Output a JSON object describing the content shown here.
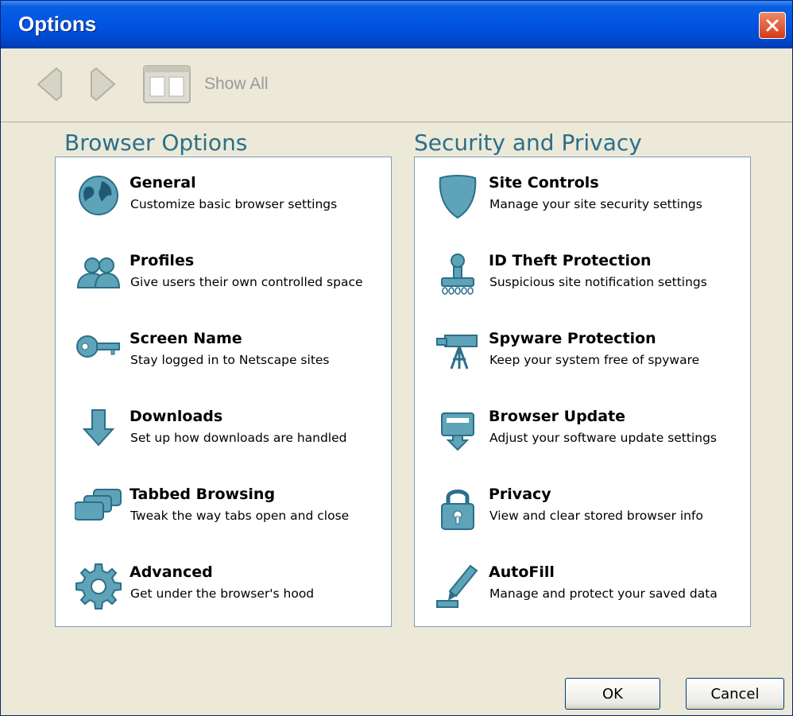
{
  "window": {
    "title": "Options"
  },
  "toolbar": {
    "show_all_label": "Show All"
  },
  "browser_options": {
    "title": "Browser Options",
    "items": [
      {
        "name": "General",
        "desc": "Customize basic browser settings",
        "icon": "globe-icon"
      },
      {
        "name": "Profiles",
        "desc": "Give users their own controlled space",
        "icon": "users-icon"
      },
      {
        "name": "Screen Name",
        "desc": "Stay logged in to Netscape sites",
        "icon": "key-icon"
      },
      {
        "name": "Downloads",
        "desc": "Set up how downloads are handled",
        "icon": "download-arrow-icon"
      },
      {
        "name": "Tabbed Browsing",
        "desc": "Tweak the way tabs open and close",
        "icon": "tabs-icon"
      },
      {
        "name": "Advanced",
        "desc": "Get under the browser's hood",
        "icon": "gear-icon"
      }
    ]
  },
  "security_privacy": {
    "title": "Security and Privacy",
    "items": [
      {
        "name": "Site Controls",
        "desc": "Manage your site security settings",
        "icon": "shield-icon"
      },
      {
        "name": "ID Theft Protection",
        "desc": "Suspicious site notification settings",
        "icon": "stamp-icon"
      },
      {
        "name": "Spyware Protection",
        "desc": "Keep your system free of spyware",
        "icon": "telescope-icon"
      },
      {
        "name": "Browser Update",
        "desc": "Adjust your software update settings",
        "icon": "update-icon"
      },
      {
        "name": "Privacy",
        "desc": "View and clear stored browser info",
        "icon": "lock-icon"
      },
      {
        "name": "AutoFill",
        "desc": "Manage and protect your saved data",
        "icon": "pen-icon"
      }
    ]
  },
  "buttons": {
    "ok": "OK",
    "cancel": "Cancel"
  },
  "colors": {
    "titlebar": "#0054e3",
    "accent": "#2b6f8a",
    "icon_fill": "#5fa3b8",
    "panel_border": "#7f9db9"
  }
}
